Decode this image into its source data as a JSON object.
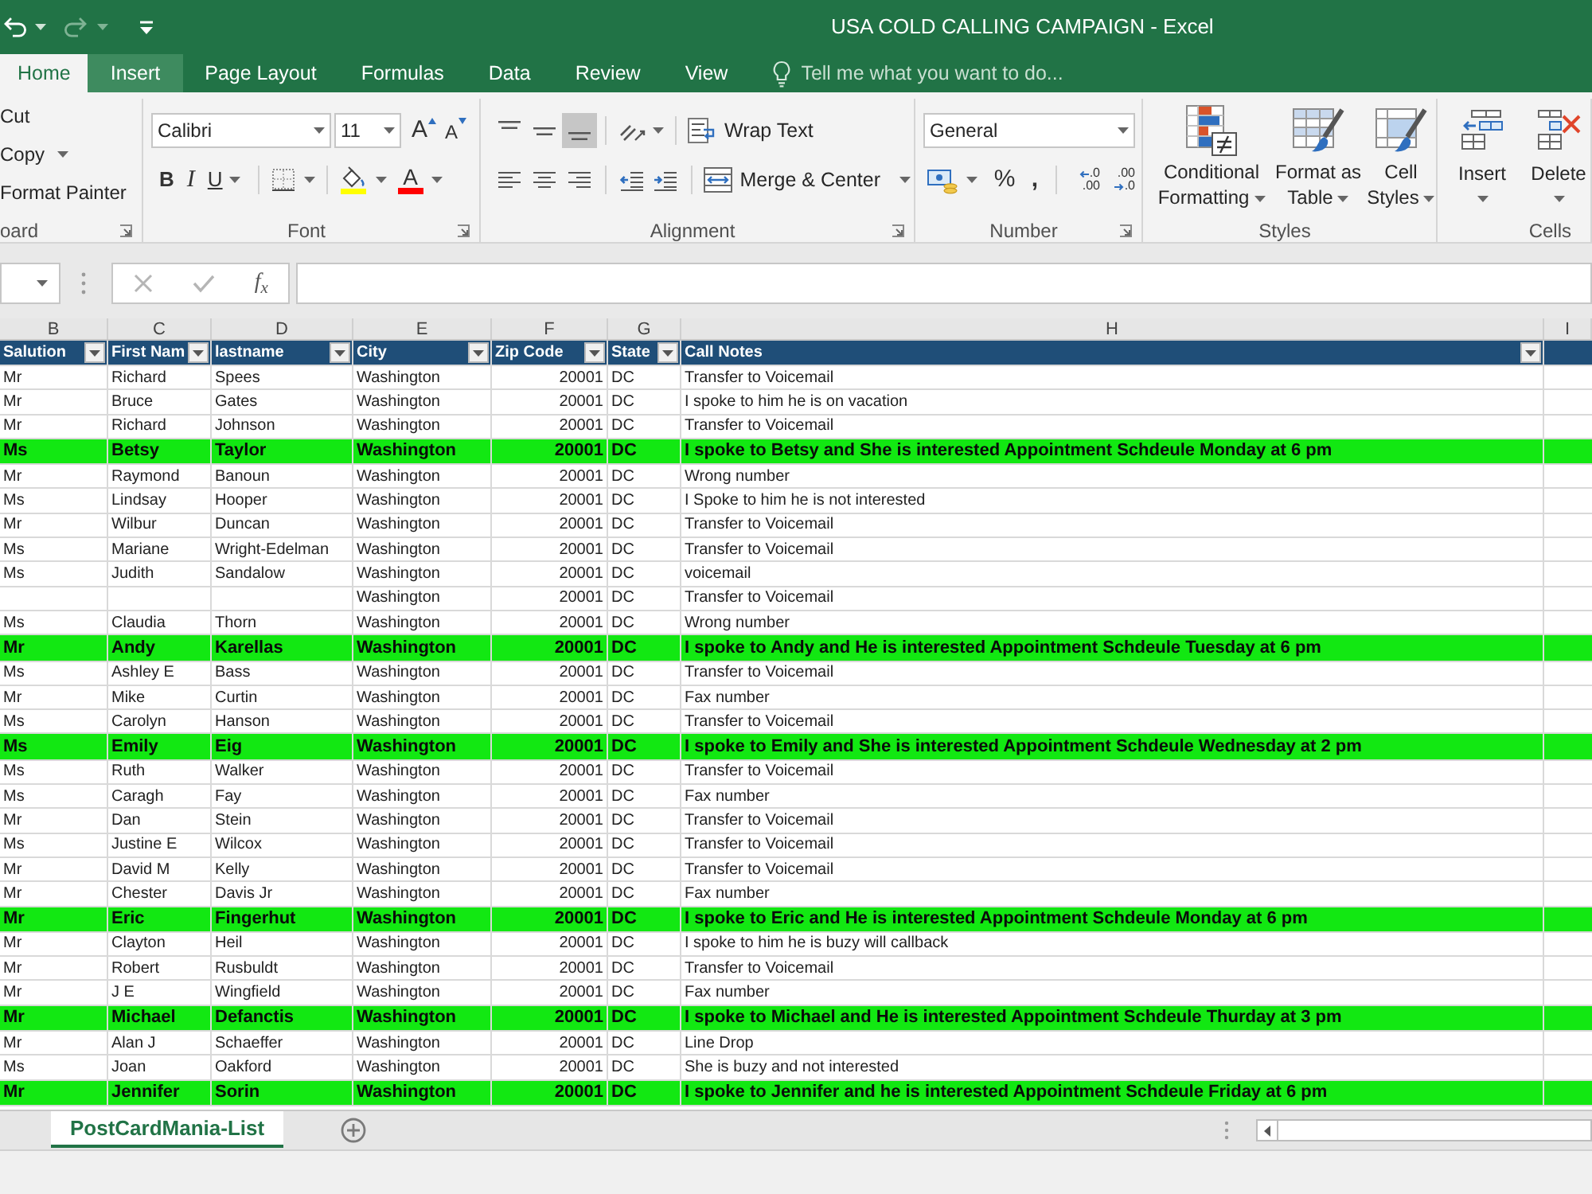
{
  "window": {
    "title": "USA COLD CALLING CAMPAIGN - Excel"
  },
  "ribbon_tabs": [
    {
      "label": "Home",
      "selected": true,
      "highlighted": false
    },
    {
      "label": "Insert",
      "selected": false,
      "highlighted": true
    },
    {
      "label": "Page Layout",
      "selected": false,
      "highlighted": false
    },
    {
      "label": "Formulas",
      "selected": false,
      "highlighted": false
    },
    {
      "label": "Data",
      "selected": false,
      "highlighted": false
    },
    {
      "label": "Review",
      "selected": false,
      "highlighted": false
    },
    {
      "label": "View",
      "selected": false,
      "highlighted": false
    }
  ],
  "tell_me": {
    "placeholder": "Tell me what you want to do..."
  },
  "ribbon": {
    "clipboard": {
      "label": "oard",
      "items": [
        {
          "label": "Cut",
          "dropdown": false
        },
        {
          "label": "Copy",
          "dropdown": true
        },
        {
          "label": "Format Painter",
          "dropdown": false
        }
      ]
    },
    "font": {
      "label": "Font",
      "font_name": "Calibri",
      "font_size": "11",
      "size_buttons": [
        {
          "label": "A",
          "kind": "grow"
        },
        {
          "label": "A",
          "kind": "shrink"
        }
      ],
      "style_buttons": [
        {
          "label": "B",
          "kind": "bold",
          "dropdown": false
        },
        {
          "label": "I",
          "kind": "italic",
          "dropdown": false
        },
        {
          "label": "U",
          "kind": "underline",
          "dropdown": true
        }
      ],
      "font_color_label": "A"
    },
    "alignment": {
      "label": "Alignment",
      "vertical": [
        {
          "kind": "top",
          "selected": false
        },
        {
          "kind": "middle",
          "selected": false
        },
        {
          "kind": "bottom",
          "selected": true
        }
      ],
      "horizontal": [
        {
          "kind": "left",
          "selected": false
        },
        {
          "kind": "center",
          "selected": false
        },
        {
          "kind": "right",
          "selected": false
        }
      ],
      "wrap_text": "Wrap Text",
      "merge": "Merge & Center"
    },
    "number": {
      "label": "Number",
      "format": "General",
      "percent": "%",
      "comma": ",",
      "decimal_buttons": [
        {
          "kind": "increase",
          "top": ".0",
          "bottom": ".00"
        },
        {
          "kind": "decrease",
          "top": ".00",
          "bottom": ".0"
        }
      ]
    },
    "styles": {
      "label": "Styles",
      "buttons": [
        {
          "kind": "conditional",
          "lines": [
            "Conditional",
            "Formatting"
          ]
        },
        {
          "kind": "table",
          "lines": [
            "Format as",
            "Table"
          ]
        },
        {
          "kind": "cell",
          "lines": [
            "Cell",
            "Styles"
          ]
        }
      ]
    },
    "cells": {
      "label": "Cells",
      "buttons": [
        {
          "kind": "insert",
          "label": "Insert"
        },
        {
          "kind": "delete",
          "label": "Delete"
        }
      ]
    }
  },
  "formula_bar": {
    "editing": false,
    "function_label": "f$_{x}$"
  },
  "column_headers": [
    "B",
    "C",
    "D",
    "E",
    "F",
    "G",
    "H",
    "I"
  ],
  "table": {
    "columns": [
      "Salution",
      "First Nam",
      "lastname",
      "City",
      "Zip Code",
      "State",
      "Call Notes"
    ],
    "rows": [
      {
        "salutation": "Mr",
        "first_name": "Richard",
        "last_name": "Spees",
        "city": "Washington",
        "zip_code": "20001",
        "state": "DC",
        "call_notes": "Transfer to Voicemail",
        "highlighted": false
      },
      {
        "salutation": "Mr",
        "first_name": "Bruce",
        "last_name": "Gates",
        "city": "Washington",
        "zip_code": "20001",
        "state": "DC",
        "call_notes": "I spoke to him he is on vacation",
        "highlighted": false
      },
      {
        "salutation": "Mr",
        "first_name": "Richard",
        "last_name": "Johnson",
        "city": "Washington",
        "zip_code": "20001",
        "state": "DC",
        "call_notes": "Transfer to Voicemail",
        "highlighted": false
      },
      {
        "salutation": "Ms",
        "first_name": "Betsy",
        "last_name": "Taylor",
        "city": "Washington",
        "zip_code": "20001",
        "state": "DC",
        "call_notes": "I spoke to Betsy and She is interested Appointment Schdeule Monday at 6 pm",
        "highlighted": true
      },
      {
        "salutation": "Mr",
        "first_name": "Raymond",
        "last_name": "Banoun",
        "city": "Washington",
        "zip_code": "20001",
        "state": "DC",
        "call_notes": "Wrong number",
        "highlighted": false
      },
      {
        "salutation": "Ms",
        "first_name": "Lindsay",
        "last_name": "Hooper",
        "city": "Washington",
        "zip_code": "20001",
        "state": "DC",
        "call_notes": "I Spoke to him he is not interested",
        "highlighted": false
      },
      {
        "salutation": "Mr",
        "first_name": "Wilbur",
        "last_name": "Duncan",
        "city": "Washington",
        "zip_code": "20001",
        "state": "DC",
        "call_notes": "Transfer to Voicemail",
        "highlighted": false
      },
      {
        "salutation": "Ms",
        "first_name": "Mariane",
        "last_name": "Wright-Edelman",
        "city": "Washington",
        "zip_code": "20001",
        "state": "DC",
        "call_notes": "Transfer to Voicemail",
        "highlighted": false
      },
      {
        "salutation": "Ms",
        "first_name": "Judith",
        "last_name": "Sandalow",
        "city": "Washington",
        "zip_code": "20001",
        "state": "DC",
        "call_notes": "voicemail",
        "highlighted": false
      },
      {
        "city": "Washington",
        "zip_code": "20001",
        "state": "DC",
        "call_notes": "Transfer to Voicemail",
        "highlighted": false
      },
      {
        "salutation": "Ms",
        "first_name": "Claudia",
        "last_name": "Thorn",
        "city": "Washington",
        "zip_code": "20001",
        "state": "DC",
        "call_notes": "Wrong number",
        "highlighted": false
      },
      {
        "salutation": "Mr",
        "first_name": "Andy",
        "last_name": "Karellas",
        "city": "Washington",
        "zip_code": "20001",
        "state": "DC",
        "call_notes": "I spoke to Andy and He is interested Appointment Schdeule Tuesday at 6 pm",
        "highlighted": true
      },
      {
        "salutation": "Ms",
        "first_name": "Ashley E",
        "last_name": "Bass",
        "city": "Washington",
        "zip_code": "20001",
        "state": "DC",
        "call_notes": "Transfer to Voicemail",
        "highlighted": false
      },
      {
        "salutation": "Mr",
        "first_name": "Mike",
        "last_name": "Curtin",
        "city": "Washington",
        "zip_code": "20001",
        "state": "DC",
        "call_notes": "Fax number",
        "highlighted": false
      },
      {
        "salutation": "Ms",
        "first_name": "Carolyn",
        "last_name": "Hanson",
        "city": "Washington",
        "zip_code": "20001",
        "state": "DC",
        "call_notes": "Transfer to Voicemail",
        "highlighted": false
      },
      {
        "salutation": "Ms",
        "first_name": "Emily",
        "last_name": "Eig",
        "city": "Washington",
        "zip_code": "20001",
        "state": "DC",
        "call_notes": "I spoke to Emily and She is interested Appointment Schdeule Wednesday at 2 pm",
        "highlighted": true
      },
      {
        "salutation": "Ms",
        "first_name": "Ruth",
        "last_name": "Walker",
        "city": "Washington",
        "zip_code": "20001",
        "state": "DC",
        "call_notes": "Transfer to Voicemail",
        "highlighted": false
      },
      {
        "salutation": "Ms",
        "first_name": "Caragh",
        "last_name": "Fay",
        "city": "Washington",
        "zip_code": "20001",
        "state": "DC",
        "call_notes": "Fax number",
        "highlighted": false
      },
      {
        "salutation": "Mr",
        "first_name": "Dan",
        "last_name": "Stein",
        "city": "Washington",
        "zip_code": "20001",
        "state": "DC",
        "call_notes": "Transfer to Voicemail",
        "highlighted": false
      },
      {
        "salutation": "Ms",
        "first_name": "Justine E",
        "last_name": "Wilcox",
        "city": "Washington",
        "zip_code": "20001",
        "state": "DC",
        "call_notes": "Transfer to Voicemail",
        "highlighted": false
      },
      {
        "salutation": "Mr",
        "first_name": "David M",
        "last_name": "Kelly",
        "city": "Washington",
        "zip_code": "20001",
        "state": "DC",
        "call_notes": "Transfer to Voicemail",
        "highlighted": false
      },
      {
        "salutation": "Mr",
        "first_name": "Chester",
        "last_name": "Davis Jr",
        "city": "Washington",
        "zip_code": "20001",
        "state": "DC",
        "call_notes": "Fax number",
        "highlighted": false
      },
      {
        "salutation": "Mr",
        "first_name": "Eric",
        "last_name": "Fingerhut",
        "city": "Washington",
        "zip_code": "20001",
        "state": "DC",
        "call_notes": "I spoke to Eric and He is interested Appointment Schdeule Monday at 6 pm",
        "highlighted": true
      },
      {
        "salutation": "Mr",
        "first_name": "Clayton",
        "last_name": "Heil",
        "city": "Washington",
        "zip_code": "20001",
        "state": "DC",
        "call_notes": "I spoke to him he is buzy will callback",
        "highlighted": false
      },
      {
        "salutation": "Mr",
        "first_name": "Robert",
        "last_name": "Rusbuldt",
        "city": "Washington",
        "zip_code": "20001",
        "state": "DC",
        "call_notes": "Transfer to Voicemail",
        "highlighted": false
      },
      {
        "salutation": "Mr",
        "first_name": "J E",
        "last_name": "Wingfield",
        "city": "Washington",
        "zip_code": "20001",
        "state": "DC",
        "call_notes": "Fax number",
        "highlighted": false
      },
      {
        "salutation": "Mr",
        "first_name": "Michael",
        "last_name": "Defanctis",
        "city": "Washington",
        "zip_code": "20001",
        "state": "DC",
        "call_notes": "I spoke to Michael and He is interested Appointment Schdeule Thurday at 3 pm",
        "highlighted": true
      },
      {
        "salutation": "Mr",
        "first_name": "Alan J",
        "last_name": "Schaeffer",
        "city": "Washington",
        "zip_code": "20001",
        "state": "DC",
        "call_notes": "Line Drop",
        "highlighted": false
      },
      {
        "salutation": "Ms",
        "first_name": "Joan",
        "last_name": "Oakford",
        "city": "Washington",
        "zip_code": "20001",
        "state": "DC",
        "call_notes": "She is buzy and not interested",
        "highlighted": false
      },
      {
        "salutation": "Mr",
        "first_name": "Jennifer",
        "last_name": "Sorin",
        "city": "Washington",
        "zip_code": "20001",
        "state": "DC",
        "call_notes": "I spoke to Jennifer and he is interested Appointment Schdeule Friday at 6 pm",
        "highlighted": true
      }
    ]
  },
  "sheet_tabs": [
    {
      "label": "PostCardMania-List",
      "selected": true
    }
  ]
}
